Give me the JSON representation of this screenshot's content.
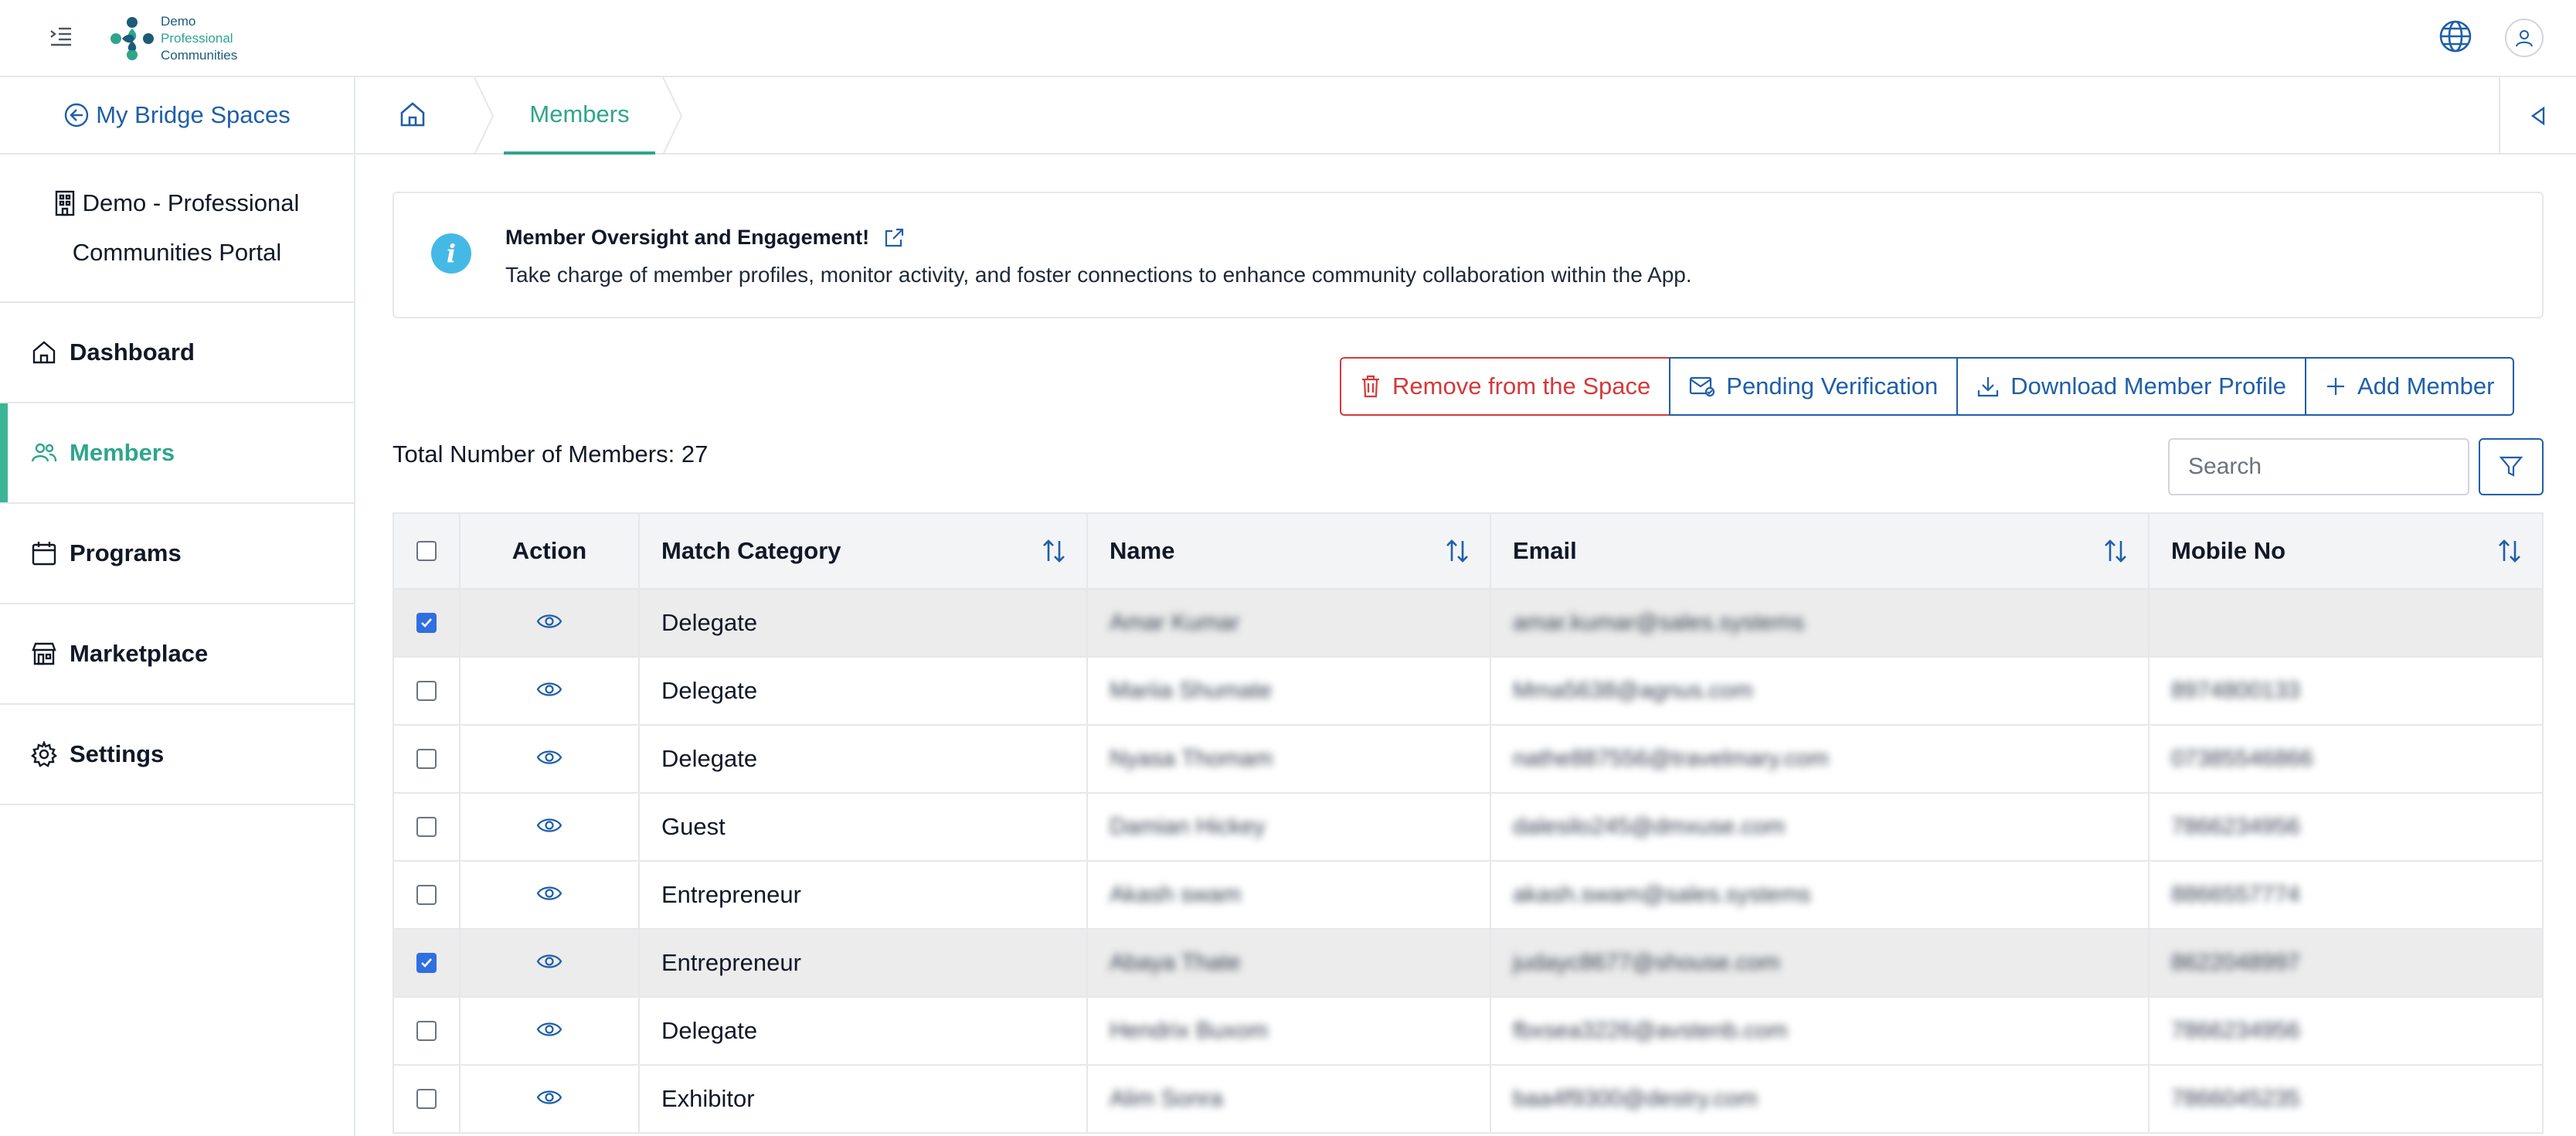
{
  "brand": {
    "logo_lines": [
      "Demo",
      "Professional",
      "Communities"
    ],
    "primary_color": "#1f5fa8",
    "accent_color": "#2fa58c",
    "danger_color": "#d33a3a"
  },
  "sidebar": {
    "back_label": "My Bridge Spaces",
    "portal_line1": "Demo - Professional",
    "portal_line2": "Communities Portal",
    "items": [
      {
        "label": "Dashboard",
        "icon": "home-icon",
        "active": false
      },
      {
        "label": "Members",
        "icon": "users-icon",
        "active": true
      },
      {
        "label": "Programs",
        "icon": "calendar-icon",
        "active": false
      },
      {
        "label": "Marketplace",
        "icon": "store-icon",
        "active": false
      },
      {
        "label": "Settings",
        "icon": "gear-icon",
        "active": false
      }
    ]
  },
  "breadcrumb": {
    "current": "Members"
  },
  "info": {
    "title": "Member Oversight and Engagement!",
    "description": "Take charge of member profiles, monitor activity, and foster connections to enhance community collaboration within the App."
  },
  "actions": {
    "remove": "Remove from the Space",
    "pending": "Pending Verification",
    "download": "Download Member Profile",
    "add": "Add Member"
  },
  "total_label": "Total Number of Members: 27",
  "search": {
    "placeholder": "Search"
  },
  "table": {
    "headers": {
      "action": "Action",
      "category": "Match Category",
      "name": "Name",
      "email": "Email",
      "mobile": "Mobile No"
    },
    "rows": [
      {
        "checked": true,
        "category": "Delegate",
        "name": "Amar Kumar",
        "email": "amar.kumar@sales.systems",
        "mobile": ""
      },
      {
        "checked": false,
        "category": "Delegate",
        "name": "Mariia Shumate",
        "email": "Mma5638@agnus.com",
        "mobile": "8974800133"
      },
      {
        "checked": false,
        "category": "Delegate",
        "name": "Nyasa Thomam",
        "email": "nathe887556@travelmary.com",
        "mobile": "07385546866"
      },
      {
        "checked": false,
        "category": "Guest",
        "name": "Damian Hickey",
        "email": "dalesilo245@dmxuse.com",
        "mobile": "7866234956"
      },
      {
        "checked": false,
        "category": "Entrepreneur",
        "name": "Akash swam",
        "email": "akash.swam@sales.systems",
        "mobile": "8866557774"
      },
      {
        "checked": true,
        "category": "Entrepreneur",
        "name": "Abaya Thate",
        "email": "judayc8677@shouse.com",
        "mobile": "8622048997"
      },
      {
        "checked": false,
        "category": "Delegate",
        "name": "Hendrix Buxom",
        "email": "fbxsea3226@avstenb.com",
        "mobile": "7866234956"
      },
      {
        "checked": false,
        "category": "Exhibitor",
        "name": "Alim Sonra",
        "email": "baa4f9300@destry.com",
        "mobile": "7866045235"
      }
    ]
  }
}
